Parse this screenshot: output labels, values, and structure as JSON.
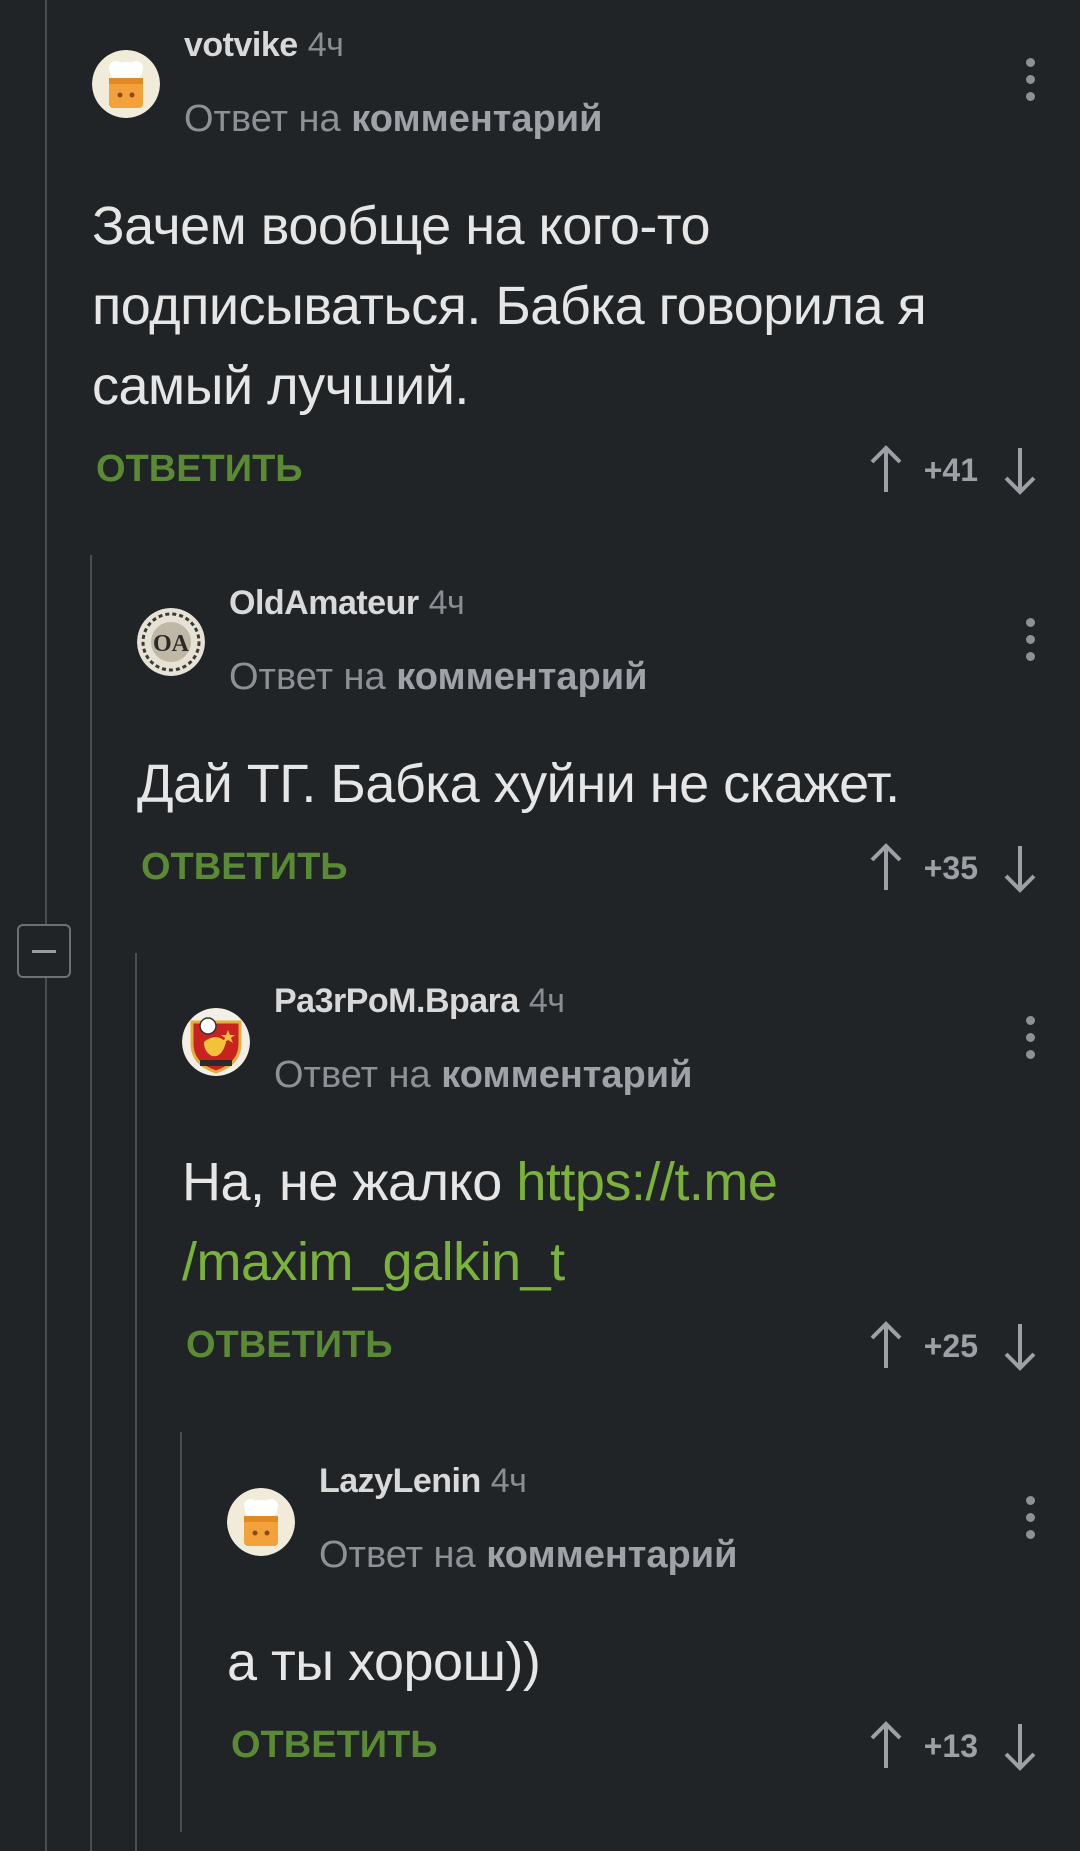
{
  "comments": [
    {
      "username": "votvike",
      "time": "4ч",
      "reply_prefix": "Ответ на",
      "reply_target": "комментарий",
      "text": "Зачем вообще на кого-то подписываться. Бабка говорила я самый лучший.",
      "reply_label": "ОТВЕТИТЬ",
      "score": "+41",
      "avatar": "chef-avatar"
    },
    {
      "username": "OldAmateur",
      "time": "4ч",
      "reply_prefix": "Ответ на",
      "reply_target": "комментарий",
      "text": "Дай ТГ. Бабка хуйни не скажет.",
      "reply_label": "ОТВЕТИТЬ",
      "score": "+35",
      "avatar": "monogram-avatar"
    },
    {
      "username": "Pa3rPoM.Bpara",
      "time": "4ч",
      "reply_prefix": "Ответ на",
      "reply_target": "комментарий",
      "text_before_link": "На, не жалко ",
      "link_line1": "https://t.me",
      "link_line2": "/maxim_galkin_t",
      "reply_label": "ОТВЕТИТЬ",
      "score": "+25",
      "avatar": "football-emblem-avatar"
    },
    {
      "username": "LazyLenin",
      "time": "4ч",
      "reply_prefix": "Ответ на",
      "reply_target": "комментарий",
      "text": "а ты хорош))",
      "reply_label": "ОТВЕТИТЬ",
      "score": "+13",
      "avatar": "chef-avatar"
    }
  ],
  "colors": {
    "background": "#212427",
    "reply_button": "#5a8a33",
    "link": "#7bb23c",
    "thread_line": "#4a4e53"
  },
  "icons": [
    "upvote-arrow-icon",
    "downvote-arrow-icon",
    "more-menu-icon",
    "collapse-thread-icon"
  ]
}
